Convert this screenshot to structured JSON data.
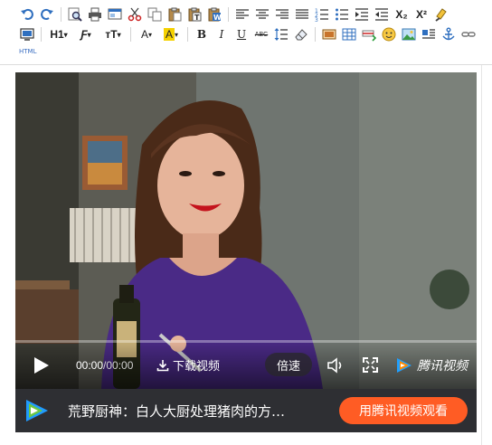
{
  "toolbar": {
    "row1_icons": [
      "undo-icon",
      "redo-icon",
      "find-replace-icon",
      "print-icon",
      "preview-icon",
      "cut-icon",
      "copy-icon",
      "paste-icon",
      "paste-text-icon",
      "paste-word-icon",
      "align-left-icon",
      "align-center-icon",
      "align-right-icon",
      "justify-icon",
      "ordered-list-icon",
      "unordered-list-icon",
      "indent-icon",
      "outdent-icon",
      "subscript-icon",
      "superscript-icon",
      "format-painter-icon"
    ],
    "row2_icons": [
      "source-code-icon",
      "heading-dropdown",
      "font-family-dropdown",
      "font-size-dropdown",
      "font-color-dropdown",
      "highlight-color-dropdown",
      "bold-icon",
      "italic-icon",
      "underline-icon",
      "strikethrough-icon",
      "line-height-icon",
      "eraser-icon",
      "image-icon",
      "table-icon",
      "insert-row-icon",
      "emoji-icon",
      "picture-icon",
      "float-left-icon",
      "anchor-icon",
      "link-icon"
    ],
    "heading_label": "H1",
    "font_label": "Ƒ",
    "size_label": "тT",
    "color_label": "A",
    "bg_color_label": "A",
    "bold_label": "B",
    "italic_label": "I",
    "underline_label": "U",
    "strike_label": "ABC",
    "sub_label": "X₂",
    "sup_label": "X²",
    "html_label": "HTML",
    "accent": "#2f6fbf"
  },
  "player": {
    "progress_fraction": 0,
    "current_time": "00:00",
    "duration": "/00:00",
    "download_label": "下载视频",
    "speed_label": "倍速",
    "brand_label": "腾讯视频",
    "title": "荒野厨神：白人大厨处理猪肉的方…",
    "watch_button": "用腾讯视频观看",
    "accent": "#ff5c24"
  }
}
